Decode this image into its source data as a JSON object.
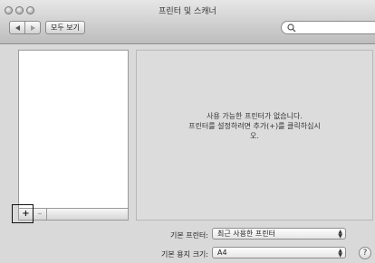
{
  "window": {
    "title": "프린터 및 스캐너"
  },
  "toolbar": {
    "back_icon": "chevron-left",
    "forward_icon": "chevron-right",
    "show_all_label": "모두 보기",
    "search_placeholder": ""
  },
  "printer_list": {
    "items": [],
    "add_label": "+",
    "remove_label": "–"
  },
  "detail": {
    "empty_message_line1": "사용 가능한 프린터가 없습니다.",
    "empty_message_line2": "프린터를 설정하려면 추가(+)를 클릭하십시",
    "empty_message_line3": "오."
  },
  "settings": {
    "default_printer_label": "기본 프린터:",
    "default_printer_value": "최근 사용한 프린터",
    "default_paper_label": "기본 용지 크기:",
    "default_paper_value": "A4",
    "help_label": "?"
  }
}
